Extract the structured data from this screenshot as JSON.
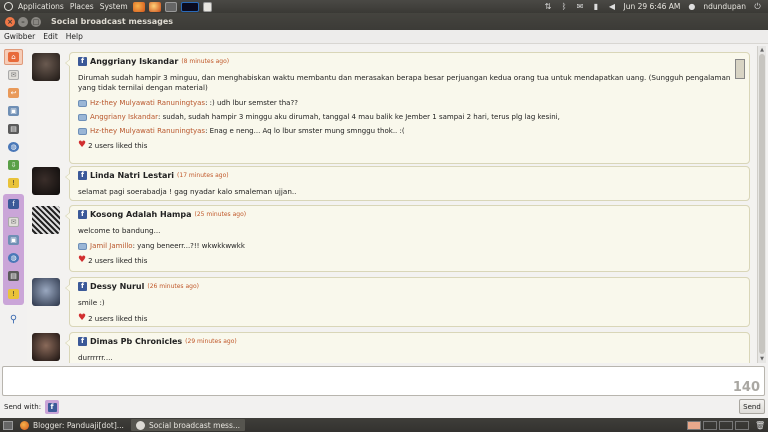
{
  "top_panel": {
    "menus": [
      "Applications",
      "Places",
      "System"
    ],
    "clock": "Jun 29  6:46 AM",
    "user": "ndundupan"
  },
  "window": {
    "title": "Social broadcast messages",
    "menus": [
      "Gwibber",
      "Edit",
      "Help"
    ]
  },
  "posts": [
    {
      "author": "Anggriany Iskandar",
      "time": "(8 minutes ago)",
      "message": "Dirumah sudah hampir 3 minguu, dan menghabiskan waktu membantu dan merasakan berapa besar perjuangan kedua orang tua untuk mendapatkan uang. (Sungguh pengalaman yang tidak ternilai dengan material)",
      "comments": [
        {
          "name": "Hz-they Mulyawati Ranuningtyas",
          "text": ": :) udh lbur semster tha??"
        },
        {
          "name": "Anggriany Iskandar",
          "text": ": sudah, sudah hampir 3 minggu aku dirumah, tanggal 4 mau balik ke Jember 1 sampai 2 hari, terus plg lag kesini,"
        },
        {
          "name": "Hz-they Mulyawati Ranuningtyas",
          "text": ": Enag e neng... Aq lo lbur smster mung smnggu thok.. :("
        }
      ],
      "likes": "2 users liked this"
    },
    {
      "author": "Linda Natri Lestari",
      "time": "(17 minutes ago)",
      "message": "selamat pagi soerabadja ! gag nyadar kalo smaleman ujjan..",
      "comments": [],
      "likes": ""
    },
    {
      "author": "Kosong Adalah Hampa",
      "time": "(25 minutes ago)",
      "message": "welcome to bandung...",
      "comments": [
        {
          "name": "Jamil Jamillo",
          "text": ": yang beneerr...?!! wkwkkwwkk"
        }
      ],
      "likes": "2 users liked this"
    },
    {
      "author": "Dessy Nurul",
      "time": "(26 minutes ago)",
      "message": "smile :)",
      "comments": [],
      "likes": "2 users liked this"
    },
    {
      "author": "Dimas Pb Chronicles",
      "time": "(29 minutes ago)",
      "message": "durrrrrr....",
      "comments": [],
      "likes": ""
    }
  ],
  "composer": {
    "char_count": "140",
    "send_with_label": "Send with:",
    "send_label": "Send"
  },
  "taskbar": {
    "tasks": [
      "Blogger: Panduaji[dot]...",
      "Social broadcast mess..."
    ]
  },
  "colors": {
    "accent": "#f07746",
    "facebook": "#3b5998",
    "link": "#b8552a"
  }
}
